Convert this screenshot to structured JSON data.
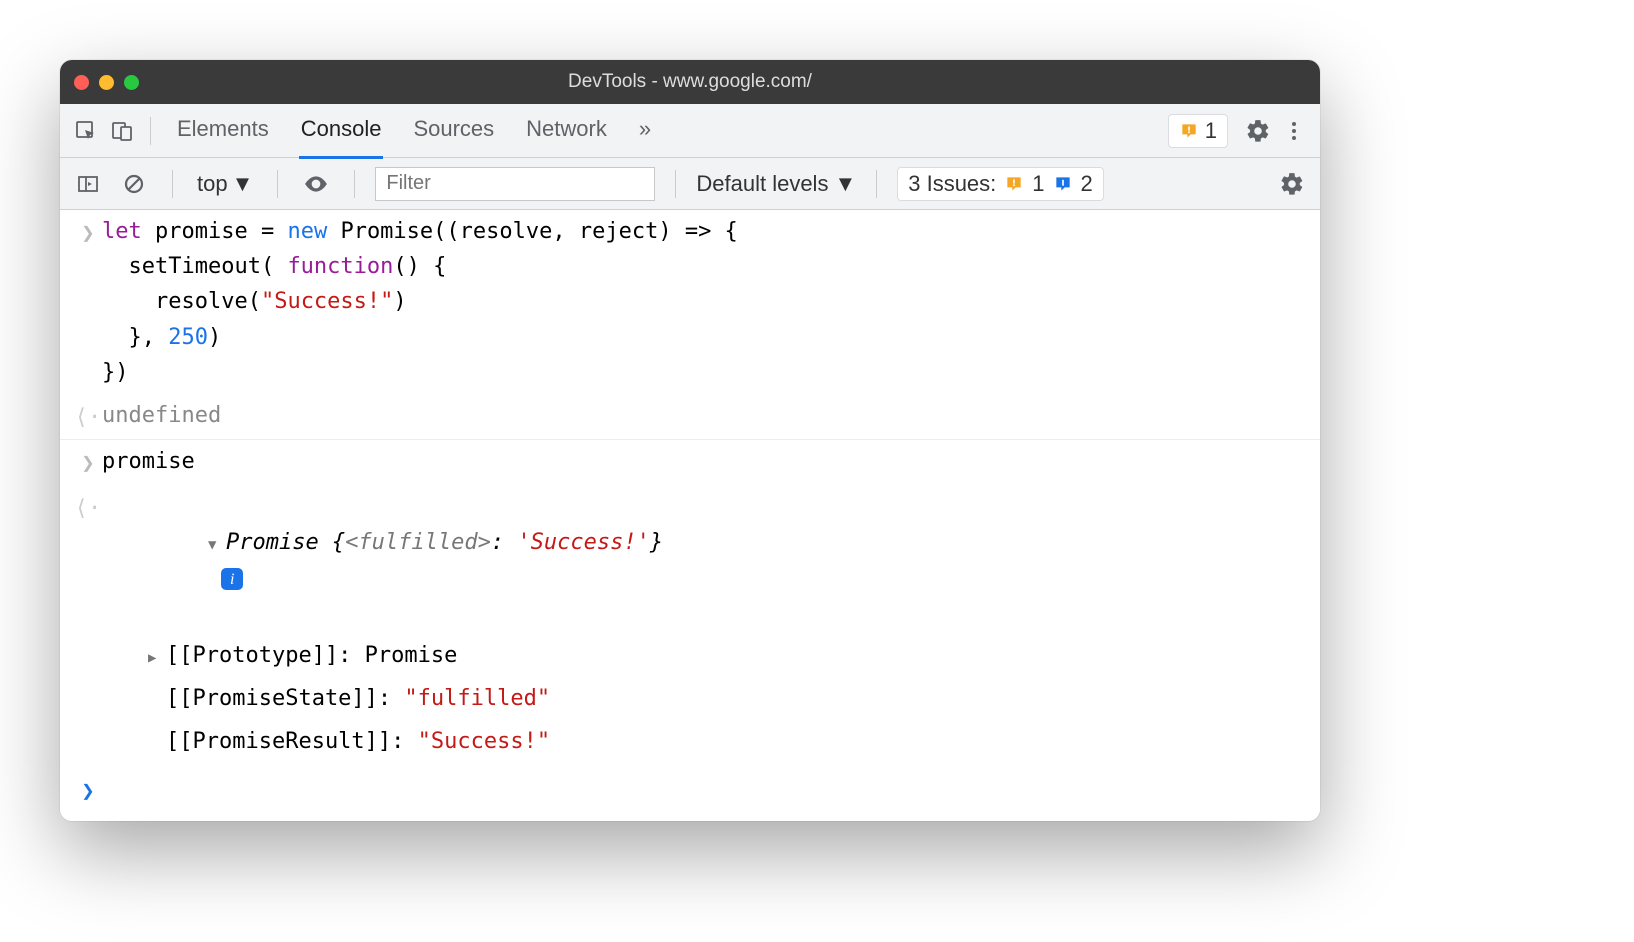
{
  "window": {
    "title": "DevTools - www.google.com/"
  },
  "tabs": {
    "items": [
      "Elements",
      "Console",
      "Sources",
      "Network"
    ],
    "active": "Console"
  },
  "header_warning": {
    "count": "1"
  },
  "subbar": {
    "context": "top",
    "filter_placeholder": "Filter",
    "levels": "Default levels",
    "issues_label": "3 Issues:",
    "issues_warn": "1",
    "issues_info": "2"
  },
  "console": {
    "code_lines": [
      {
        "t": "decl",
        "v": "let"
      },
      {
        "t": "plain",
        "v": " promise = "
      },
      {
        "t": "new",
        "v": "new"
      },
      {
        "t": "plain",
        "v": " Promise((resolve, reject) => {\n"
      },
      {
        "t": "plain",
        "v": "  setTimeout( "
      },
      {
        "t": "func",
        "v": "function"
      },
      {
        "t": "plain",
        "v": "() {\n"
      },
      {
        "t": "plain",
        "v": "    resolve("
      },
      {
        "t": "str",
        "v": "\"Success!\""
      },
      {
        "t": "plain",
        "v": ")\n"
      },
      {
        "t": "plain",
        "v": "  }, "
      },
      {
        "t": "num",
        "v": "250"
      },
      {
        "t": "plain",
        "v": ")\n"
      },
      {
        "t": "plain",
        "v": "})"
      }
    ],
    "result1": "undefined",
    "input2": "promise",
    "result2": {
      "ctor": "Promise",
      "state_lbl": "<fulfilled>",
      "value": "'Success!'",
      "props": [
        {
          "k": "[[Prototype]]",
          "valPlain": "Promise"
        },
        {
          "k": "[[PromiseState]]",
          "valStr": "\"fulfilled\""
        },
        {
          "k": "[[PromiseResult]]",
          "valStr": "\"Success!\""
        }
      ]
    }
  }
}
